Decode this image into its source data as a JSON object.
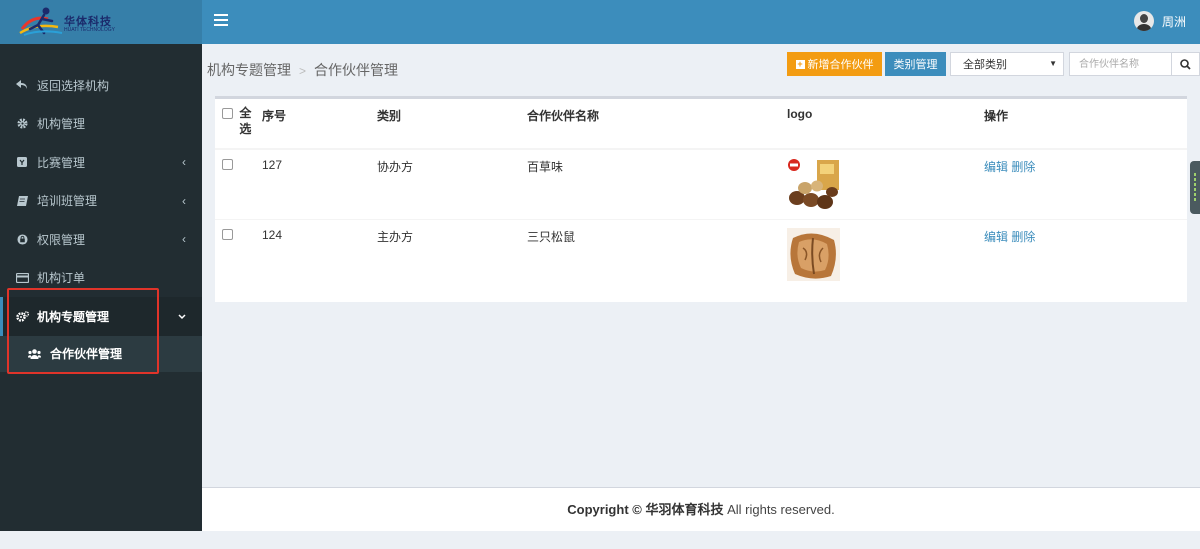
{
  "brand": {
    "name": "华体科技",
    "subtitle": "HUATI TECHNOLOGY"
  },
  "user": {
    "name": "周洲"
  },
  "sidebar": {
    "items": [
      {
        "label": "返回选择机构",
        "icon": "back-arrow-icon",
        "has_chevron": false
      },
      {
        "label": "机构管理",
        "icon": "gear-icon",
        "has_chevron": false
      },
      {
        "label": "比赛管理",
        "icon": "badge-icon",
        "has_chevron": true
      },
      {
        "label": "培训班管理",
        "icon": "book-icon",
        "has_chevron": true
      },
      {
        "label": "权限管理",
        "icon": "lock-icon",
        "has_chevron": true
      },
      {
        "label": "机构订单",
        "icon": "credit-card-icon",
        "has_chevron": false
      },
      {
        "label": "机构专题管理",
        "icon": "gears-icon",
        "has_chevron": true,
        "active": true
      }
    ],
    "subitems": [
      {
        "label": "合作伙伴管理",
        "icon": "users-icon"
      }
    ]
  },
  "breadcrumb": {
    "parent": "机构专题管理",
    "separator": ">",
    "current": "合作伙伴管理"
  },
  "toolbar": {
    "add_label": "新增合作伙伴",
    "category_label": "类别管理",
    "filter_selected": "全部类别",
    "search_placeholder": "合作伙伴名称"
  },
  "table": {
    "headers": {
      "select_all": "全选",
      "seq": "序号",
      "category": "类别",
      "name": "合作伙伴名称",
      "logo": "logo",
      "ops": "操作"
    },
    "rows": [
      {
        "seq": "127",
        "category": "协办方",
        "name": "百草味",
        "logo": "macadamia-nut-image",
        "edit": "编辑",
        "delete": "删除"
      },
      {
        "seq": "124",
        "category": "主办方",
        "name": "三只松鼠",
        "logo": "pecan-nut-image",
        "edit": "编辑",
        "delete": "删除"
      }
    ]
  },
  "footer": {
    "prefix": "Copyright © ",
    "company": "华羽体育科技",
    "suffix": " All rights reserved."
  },
  "colors": {
    "header_blue": "#3c8dbc",
    "sidebar_dark": "#222d32",
    "add_orange": "#f39c12",
    "highlight_red": "#e0342a"
  }
}
